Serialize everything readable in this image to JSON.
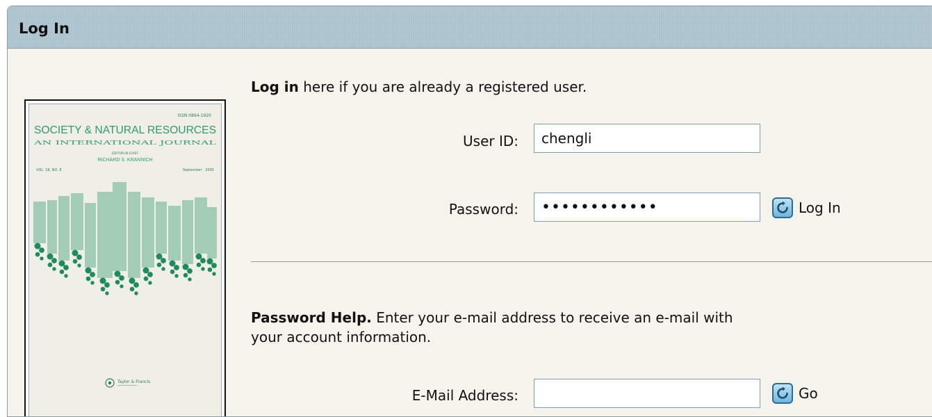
{
  "panel": {
    "title": "Log In"
  },
  "cover": {
    "issn": "ISSN 0894-1920",
    "journal_title": "SOCIETY & NATURAL RESOURCES",
    "subtitle": "AN INTERNATIONAL JOURNAL",
    "editor_label": "EDITOR-IN-CHIEF",
    "editor_name": "RICHARD S. KRANNICH",
    "volume": "VOL. 18, NO. 8",
    "date": "September · 2005",
    "publisher": "Taylor & Francis"
  },
  "login": {
    "intro_bold": "Log in",
    "intro_rest": " here if you are already a registered user.",
    "user_id_label": "User ID:",
    "user_id_value": "chengli",
    "password_label": "Password:",
    "password_value": "••••••••••••",
    "submit_label": "Log In"
  },
  "password_help": {
    "bold": "Password Help.",
    "line1_rest": " Enter your e-mail address to receive an e-mail with",
    "line2": "your account information.",
    "email_label": "E-Mail Address:",
    "email_value": "",
    "go_label": "Go"
  },
  "colors": {
    "titlebar": "#a9c1cc",
    "panel_bg": "#f5f4ec",
    "cover_green": "#2f9a6a",
    "button_blue": "#6fb6de"
  }
}
